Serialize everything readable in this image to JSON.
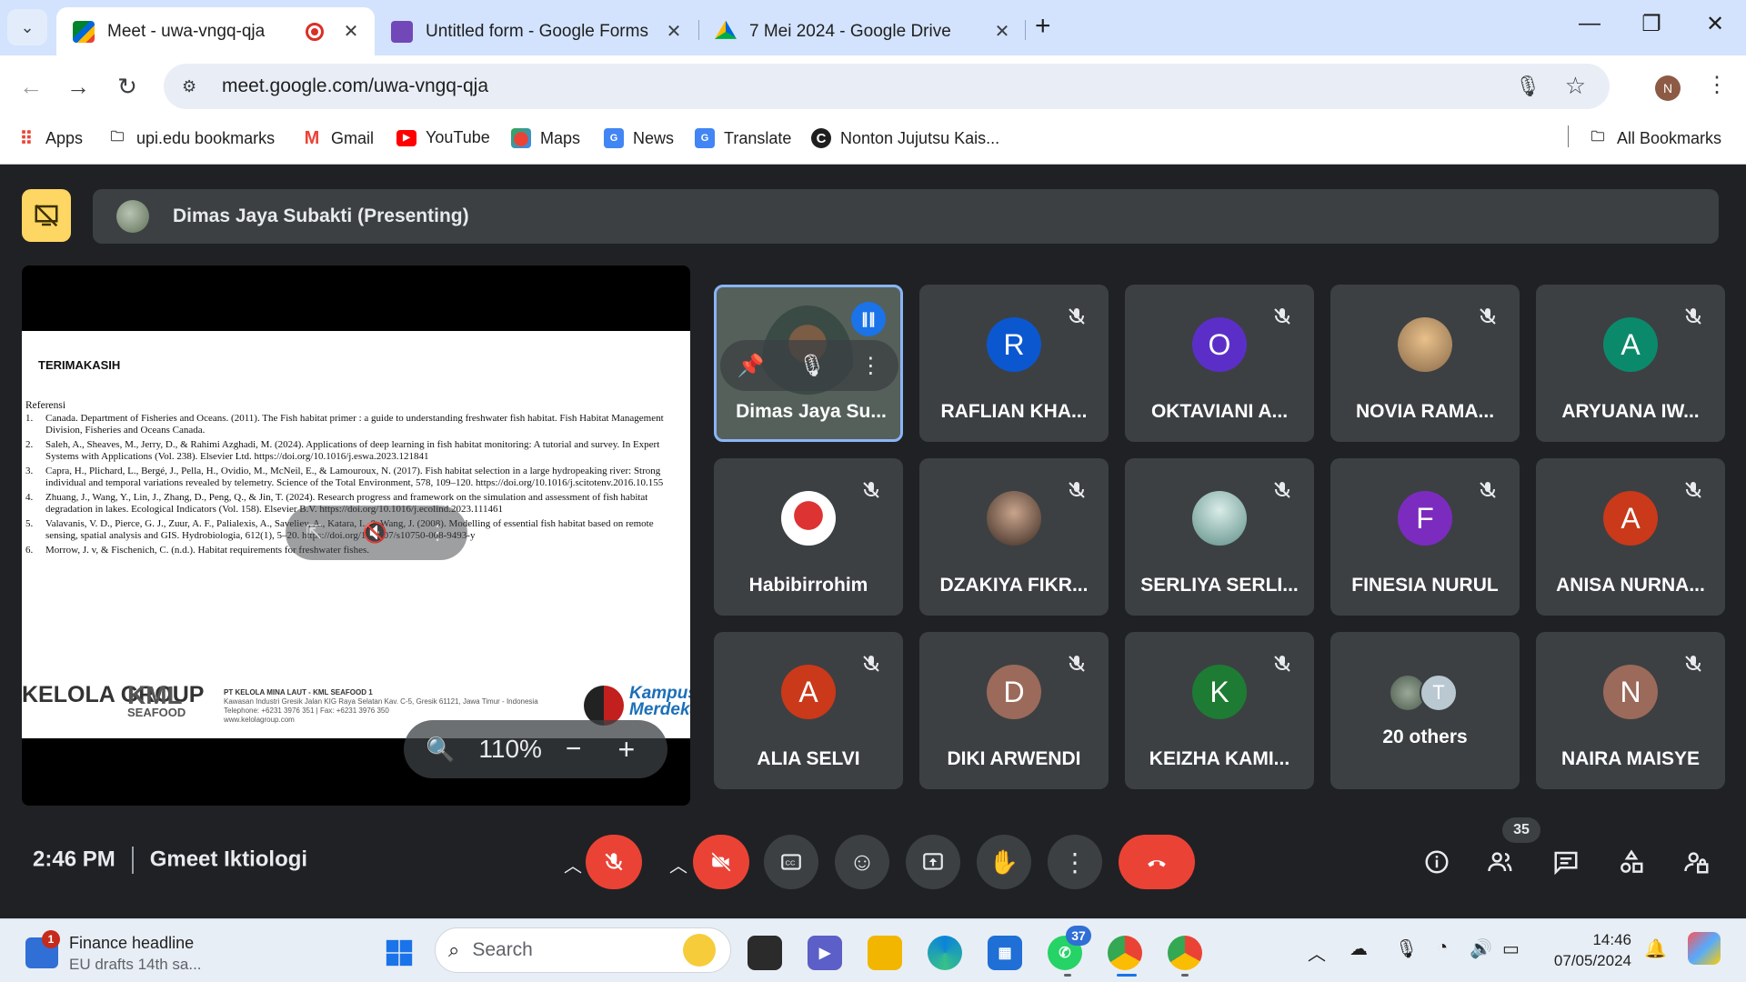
{
  "browser": {
    "tabs": [
      {
        "title": "Meet - uwa-vngq-qja",
        "active": true,
        "favicon": "google-meet-icon",
        "recording": true
      },
      {
        "title": "Untitled form - Google Forms",
        "active": false,
        "favicon": "google-forms-icon"
      },
      {
        "title": "7 Mei 2024 - Google Drive",
        "active": false,
        "favicon": "google-drive-icon"
      }
    ],
    "url": "meet.google.com/uwa-vngq-qja",
    "profile_initial": "N",
    "bookmarks": [
      {
        "label": "Apps",
        "icon": "apps-grid-icon"
      },
      {
        "label": "upi.edu bookmarks",
        "icon": "folder-icon"
      },
      {
        "label": "Gmail",
        "icon": "gmail-icon"
      },
      {
        "label": "YouTube",
        "icon": "youtube-icon"
      },
      {
        "label": "Maps",
        "icon": "maps-icon"
      },
      {
        "label": "News",
        "icon": "news-icon"
      },
      {
        "label": "Translate",
        "icon": "translate-icon"
      },
      {
        "label": "Nonton Jujutsu Kais...",
        "icon": "site-c-icon"
      }
    ],
    "all_bookmarks": "All Bookmarks"
  },
  "meet": {
    "presenter_label": "Dimas Jaya Subakti (Presenting)",
    "slide": {
      "title": "TERIMAKASIH",
      "ref_heading": "Referensi",
      "refs": [
        {
          "n": "1.",
          "text": "Canada. Department of Fisheries and Oceans. (2011). The Fish habitat primer : a guide to understanding freshwater fish habitat. Fish Habitat Management Division, Fisheries and Oceans Canada."
        },
        {
          "n": "2.",
          "text": "Saleh, A., Sheaves, M., Jerry, D., & Rahimi Azghadi, M. (2024). Applications of deep learning in fish habitat monitoring: A tutorial and survey. In Expert Systems with Applications (Vol. 238). Elsevier Ltd. https://doi.org/10.1016/j.eswa.2023.121841"
        },
        {
          "n": "3.",
          "text": "Capra, H., Plichard, L., Bergé, J., Pella, H., Ovidio, M., McNeil, E., & Lamouroux, N. (2017). Fish habitat selection in a large hydropeaking river: Strong individual and temporal variations revealed by telemetry. Science of the Total Environment, 578, 109–120. https://doi.org/10.1016/j.scitotenv.2016.10.155"
        },
        {
          "n": "4.",
          "text": "Zhuang, J., Wang, Y., Lin, J., Zhang, D., Peng, Q., & Jin, T. (2024). Research progress and framework on the simulation and assessment of fish habitat degradation in lakes. Ecological Indicators (Vol. 158). Elsevier B.V. https://doi.org/10.1016/j.ecolind.2023.111461"
        },
        {
          "n": "5.",
          "text": "Valavanis, V. D., Pierce, G. J., Zuur, A. F., Palialexis, A., Saveliev, A., Katara, I., & Wang, J. (2008). Modelling of essential fish habitat based on remote sensing, spatial analysis and GIS. Hydrobiologia, 612(1), 5–20. https://doi.org/10.1007/s10750-008-9493-y"
        },
        {
          "n": "6.",
          "text": "Morrow, J. v, & Fischenich, C. (n.d.). Habitat requirements for freshwater fishes."
        }
      ],
      "logo_left": "KELOLA GROUP",
      "logo_kml": "KML",
      "logo_kml_sub": "SEAFOOD",
      "address_line1": "PT KELOLA MINA LAUT - KML SEAFOOD 1",
      "address_line2": "Kawasan Industri Gresik Jalan KIG Raya Selatan Kav. C-5, Gresik 61121, Jawa Timur - Indonesia",
      "address_line3": "Telephone: +6231 3976 351 | Fax: +6231 3976 350",
      "address_line4": "www.kelolagroup.com",
      "logo_right": "Kampus Merdeka"
    },
    "zoom_level": "110%",
    "participants": [
      {
        "name": "Dimas Jaya Su...",
        "initial": "",
        "color": "",
        "self": true
      },
      {
        "name": "RAFLIAN KHA...",
        "initial": "R",
        "color": "#0b57d0"
      },
      {
        "name": "OKTAVIANI A...",
        "initial": "O",
        "color": "#5b2fc7"
      },
      {
        "name": "NOVIA RAMA...",
        "initial": "",
        "color": "#c9a070"
      },
      {
        "name": "ARYUANA IW...",
        "initial": "A",
        "color": "#0b8a6b"
      },
      {
        "name": "Habibirrohim",
        "initial": "",
        "color": "#ffffff"
      },
      {
        "name": "DZAKIYA FIKR...",
        "initial": "",
        "color": "#6b5448"
      },
      {
        "name": "SERLIYA SERLI...",
        "initial": "",
        "color": "#7fb0ad"
      },
      {
        "name": "FINESIA NURUL",
        "initial": "F",
        "color": "#7b2cbf"
      },
      {
        "name": "ANISA NURNA...",
        "initial": "A",
        "color": "#c9391a"
      },
      {
        "name": "ALIA SELVI",
        "initial": "A",
        "color": "#c9391a"
      },
      {
        "name": "DIKI ARWENDI",
        "initial": "D",
        "color": "#9b6a5a"
      },
      {
        "name": "KEIZHA KAMI...",
        "initial": "K",
        "color": "#1e7b34"
      },
      {
        "name": "20 others",
        "initial": "T",
        "color": "#b9c8d1"
      },
      {
        "name": "NAIRA MAISYE",
        "initial": "N",
        "color": "#9b6a5a"
      }
    ],
    "time": "2:46 PM",
    "meeting_name": "Gmeet Iktiologi",
    "people_count": "35"
  },
  "taskbar": {
    "news_badge": "1",
    "news_title": "Finance headline",
    "news_sub": "EU drafts 14th sa...",
    "search_placeholder": "Search",
    "whatsapp_badge": "37",
    "time": "14:46",
    "date": "07/05/2024"
  },
  "colors": {
    "meet_bg": "#202124",
    "tile_bg": "#3c4043",
    "end_call": "#ea4335",
    "present_yellow": "#fdd663",
    "accent_blue": "#8ab4f8"
  }
}
